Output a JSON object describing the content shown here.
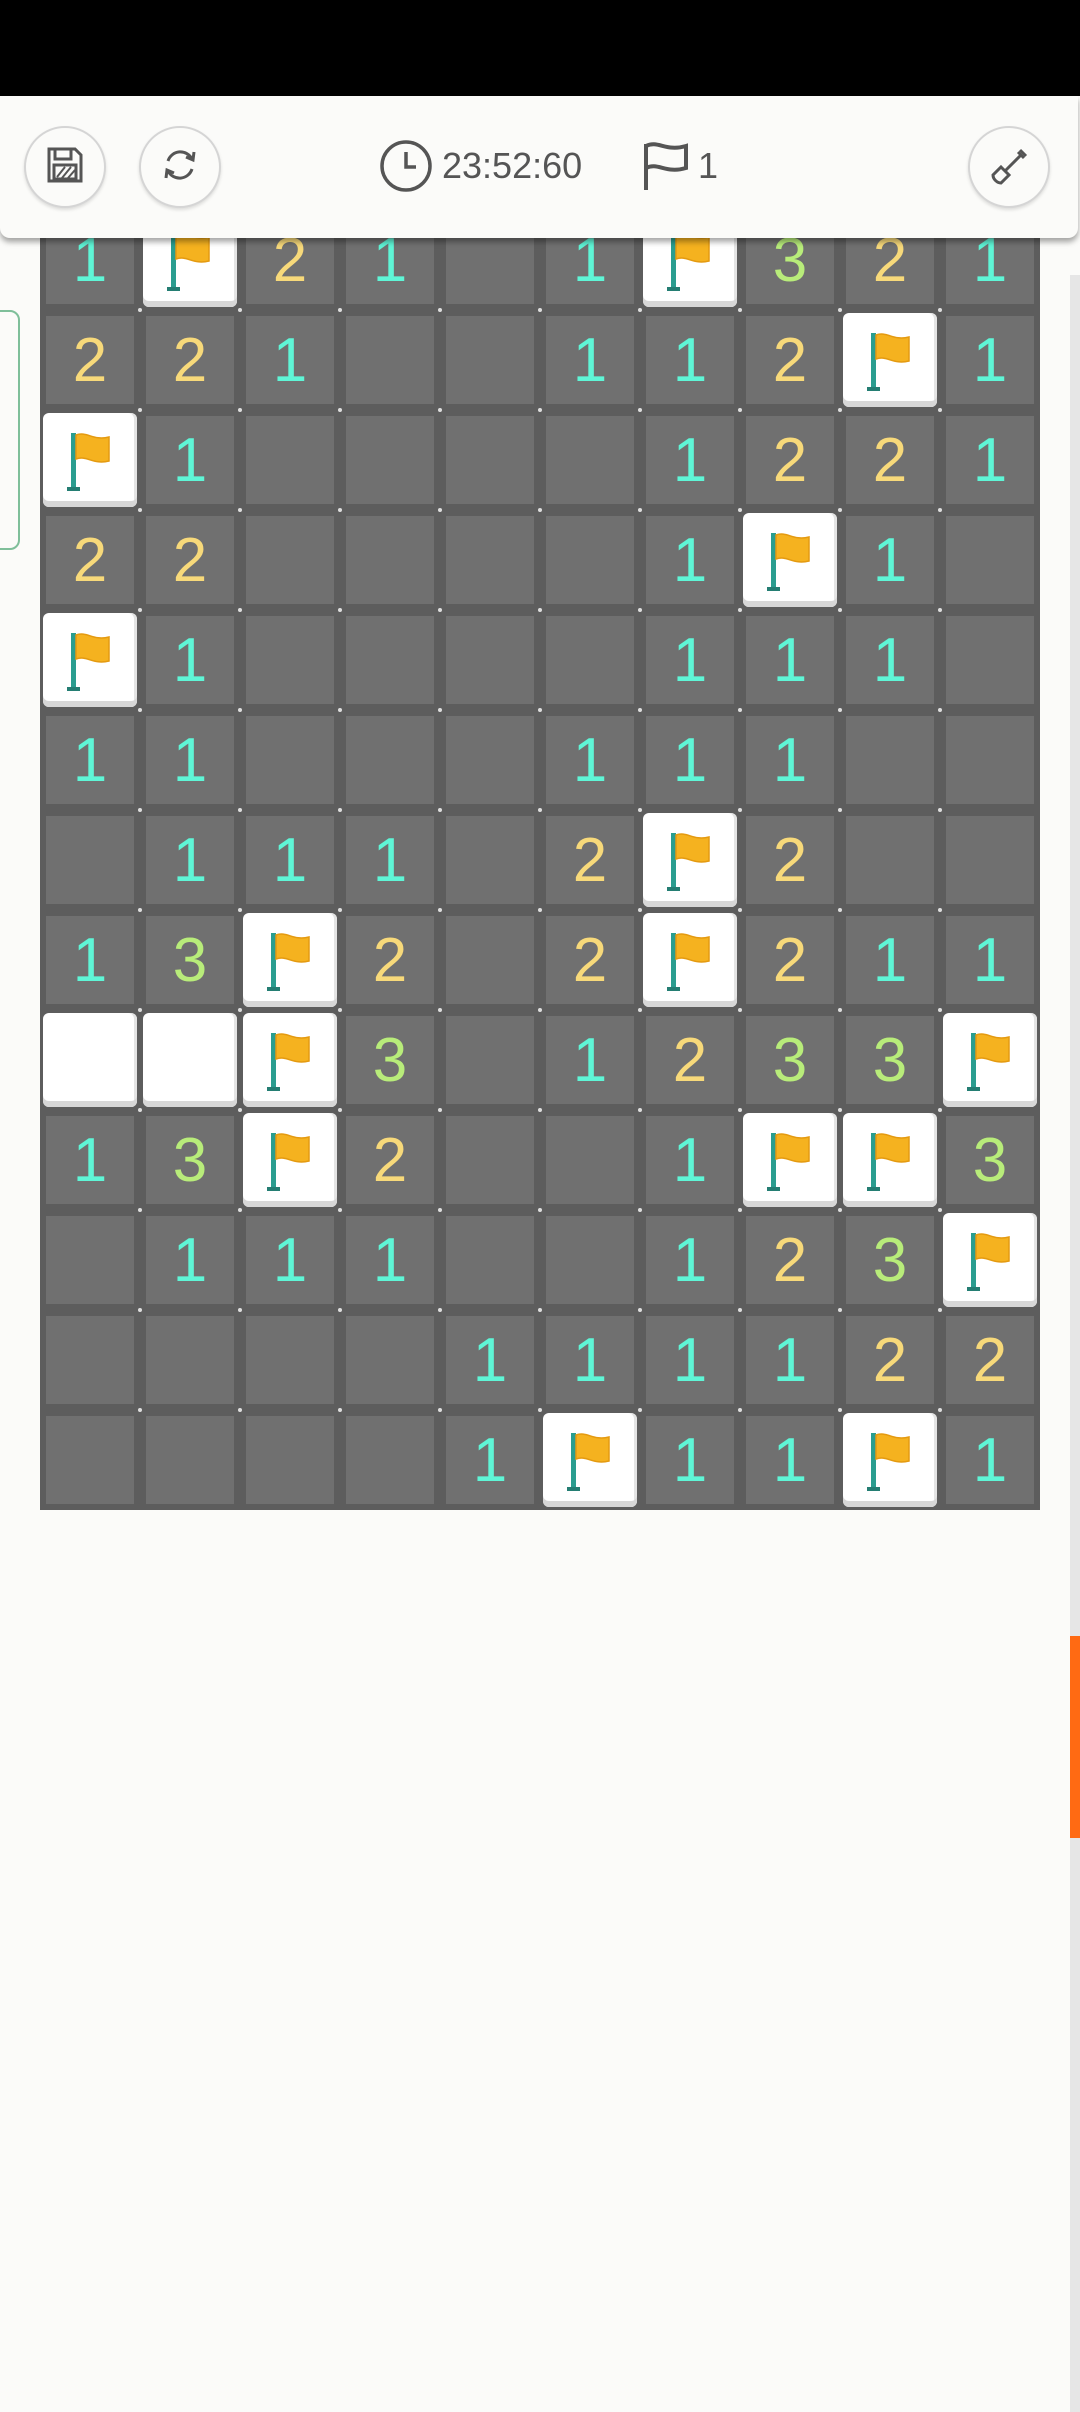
{
  "status_bar": {},
  "toolbar": {
    "save_icon": "floppy-disk-icon",
    "restart_icon": "refresh-icon",
    "timer_icon": "clock-icon",
    "timer_value": "23:52:60",
    "flag_icon": "flag-outline-icon",
    "flag_count": "1",
    "dig_icon": "shovel-icon"
  },
  "board": {
    "columns": 10,
    "visible_rows": 13,
    "rows": [
      [
        "1",
        "F",
        "2",
        "1",
        "",
        "1",
        "F",
        "3",
        "2",
        "1"
      ],
      [
        "2",
        "2",
        "1",
        "",
        "",
        "1",
        "1",
        "2",
        "F",
        "1"
      ],
      [
        "F",
        "1",
        "",
        "",
        "",
        "",
        "1",
        "2",
        "2",
        "1"
      ],
      [
        "2",
        "2",
        "",
        "",
        "",
        "",
        "1",
        "F",
        "1",
        ""
      ],
      [
        "F",
        "1",
        "",
        "",
        "",
        "",
        "1",
        "1",
        "1",
        ""
      ],
      [
        "1",
        "1",
        "",
        "",
        "",
        "1",
        "1",
        "1",
        "",
        ""
      ],
      [
        "",
        "1",
        "1",
        "1",
        "",
        "2",
        "F",
        "2",
        "",
        ""
      ],
      [
        "1",
        "3",
        "F",
        "2",
        "",
        "2",
        "F",
        "2",
        "1",
        "1"
      ],
      [
        "C",
        "C",
        "F",
        "3",
        "",
        "1",
        "2",
        "3",
        "3",
        "F"
      ],
      [
        "1",
        "3",
        "F",
        "2",
        "",
        "",
        "1",
        "F",
        "F",
        "3"
      ],
      [
        "",
        "1",
        "1",
        "1",
        "",
        "",
        "1",
        "2",
        "3",
        "F"
      ],
      [
        "",
        "",
        "",
        "",
        "1",
        "1",
        "1",
        "1",
        "2",
        "2"
      ],
      [
        "",
        "",
        "",
        "",
        "1",
        "F",
        "1",
        "1",
        "F",
        "1"
      ]
    ],
    "legend": {
      "F": "flagged tile",
      "C": "unrevealed tile"
    },
    "colors": {
      "n1": "#5ff5d6",
      "n2": "#f7d97a",
      "n3": "#b8ec7a",
      "open_cell": "#707070",
      "closed_tile": "#ffffff",
      "flag": "#f5b21f"
    }
  },
  "scrollbar": {
    "thumb_color": "#ff6a13"
  }
}
